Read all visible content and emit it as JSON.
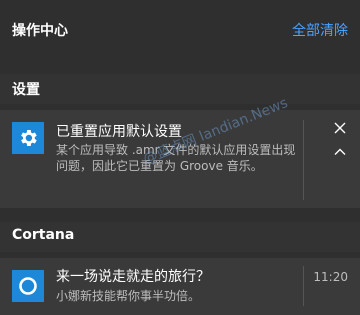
{
  "header": {
    "title": "操作中心",
    "clear_all": "全部清除"
  },
  "groups": [
    {
      "name": "设置",
      "notification": {
        "icon": "gear-icon",
        "title": "已重置应用默认设置",
        "body": "某个应用导致 .amr 文件的默认应用设置出现问题，因此它已重置为 Groove 音乐。"
      }
    },
    {
      "name": "Cortana",
      "notification": {
        "icon": "cortana-circle-icon",
        "title": "来一场说走就走的旅行？",
        "body": "小娜新技能帮你事半功倍。",
        "time": "11:20"
      }
    }
  ],
  "watermark": "@蓝点网 landian.News",
  "colors": {
    "accent": "#4aa3ff",
    "icon_bg": "#1e88d8"
  }
}
